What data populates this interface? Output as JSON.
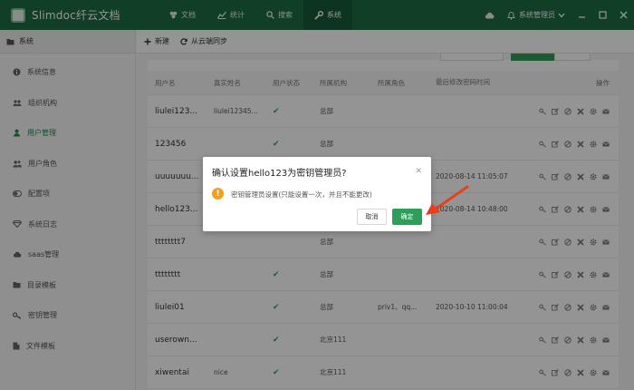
{
  "app": {
    "title": "Slimdoc纤云文档"
  },
  "topnav": [
    {
      "label": "文档",
      "icon": "docs-icon"
    },
    {
      "label": "统计",
      "icon": "chart-icon"
    },
    {
      "label": "搜索",
      "icon": "search-icon"
    },
    {
      "label": "系统",
      "icon": "wrench-icon",
      "active": true
    }
  ],
  "topbar": {
    "user": "系统管理员"
  },
  "sidebar": {
    "header": "系统",
    "items": [
      {
        "label": "系统信息",
        "icon": "info-icon"
      },
      {
        "label": "组织机构",
        "icon": "org-icon"
      },
      {
        "label": "用户管理",
        "icon": "user-icon",
        "active": true
      },
      {
        "label": "用户角色",
        "icon": "users-icon"
      },
      {
        "label": "配置项",
        "icon": "toggle-icon"
      },
      {
        "label": "系统日志",
        "icon": "diamond-icon"
      },
      {
        "label": "saas管理",
        "icon": "cloud-icon"
      },
      {
        "label": "目录模板",
        "icon": "folder-icon"
      },
      {
        "label": "密钥管理",
        "icon": "key-icon"
      },
      {
        "label": "文件模板",
        "icon": "file-icon"
      }
    ]
  },
  "toolbar": {
    "new_label": "新建",
    "sync_label": "从云端同步"
  },
  "table": {
    "headers": [
      "用户名",
      "真实姓名",
      "用户状态",
      "所属机构",
      "所属角色",
      "最后修改密码时间",
      "操作"
    ],
    "rows": [
      {
        "username": "liulei123...",
        "realname": "liulei12345...",
        "status": "✔",
        "org": "总部",
        "role": "",
        "time": ""
      },
      {
        "username": "123456",
        "realname": "",
        "status": "✔",
        "org": "总部",
        "role": "",
        "time": ""
      },
      {
        "username": "uuuuuuu...",
        "realname": "",
        "status": "",
        "org": "",
        "role": "",
        "time": "2020-08-14 11:05:07"
      },
      {
        "username": "hello123...",
        "realname": "",
        "status": "",
        "org": "",
        "role": "",
        "time": "2020-08-14 10:48:00"
      },
      {
        "username": "tttttttt7",
        "realname": "",
        "status": "",
        "org": "总部",
        "role": "",
        "time": ""
      },
      {
        "username": "tttttttt",
        "realname": "",
        "status": "✔",
        "org": "总部",
        "role": "",
        "time": ""
      },
      {
        "username": "liulei01",
        "realname": "",
        "status": "✔",
        "org": "总部",
        "role": "priv1、qq...",
        "time": "2020-10-10 11:00:04"
      },
      {
        "username": "userown...",
        "realname": "",
        "status": "✔",
        "org": "北京111",
        "role": "",
        "time": ""
      },
      {
        "username": "xiwentai",
        "realname": "nice",
        "status": "✔",
        "org": "北京111",
        "role": "",
        "time": ""
      }
    ]
  },
  "dialog": {
    "title": "确认设置hello123为密钥管理员?",
    "message": "密钥管理员设置(只能设置一次，并且不能更改)",
    "cancel": "取消",
    "ok": "确定"
  },
  "colors": {
    "brand": "#1d6b44",
    "accent": "#2e9e5b",
    "warn": "#f0a020",
    "arrow": "#e8401c"
  }
}
